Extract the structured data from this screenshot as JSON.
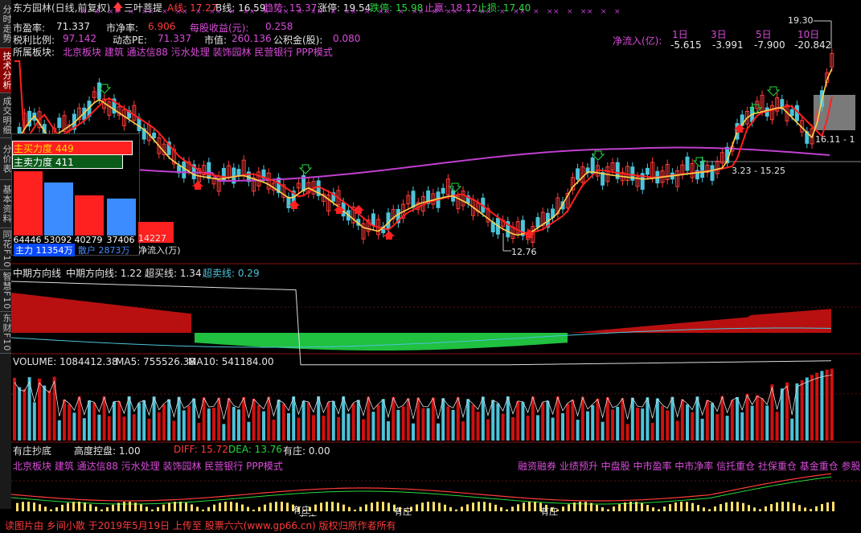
{
  "sidebar": {
    "tabs": [
      {
        "label": "分时走势",
        "active": false
      },
      {
        "label": "技术分析",
        "active": true
      },
      {
        "label": "成交明细",
        "active": false
      },
      {
        "label": "分价表",
        "active": false
      },
      {
        "label": "基本资料",
        "active": false
      },
      {
        "label": "同花F10",
        "active": false
      },
      {
        "label": "智慧F10",
        "active": false
      },
      {
        "label": "东财F10",
        "active": false
      }
    ]
  },
  "header": {
    "stock_name": "东方园林(日线,前复权)",
    "indicator_name": "三叶菩提",
    "a_line": "A线: 17.27",
    "b_line": "B线: 16.59",
    "trend": "趋势: 15.37",
    "limit_up": "涨停: 19.54",
    "limit_down": "跌停: 15.98",
    "take_profit": "止赢: 18.12",
    "stop_loss": "止损: 17.40"
  },
  "fundamentals": {
    "pe_label": "市盈率:",
    "pe_value": "71.337",
    "pb_label": "市净率:",
    "pb_value": "6.906",
    "eps_label": "每股收益(元):",
    "eps_value": "0.258",
    "pre_tax_pe_label": "税利比例:",
    "pre_tax_pe_value": "97.142",
    "dynamic_pe_label": "动态PE:",
    "dynamic_pe_value": "71.337",
    "market_cap_label": "市值:",
    "market_cap_value": "260.136",
    "reserve_label": "公积金(股):",
    "reserve_value": "0.080",
    "sector_label": "所属板块:",
    "sectors": "北京板块    建筑        通达信88 污水处理 装饰园林 民营银行 PPP模式"
  },
  "net_inflow": {
    "label": "净流入(亿):",
    "periods": [
      "1日",
      "3日",
      "5日",
      "10日"
    ],
    "values": [
      "-5.615",
      "-3.991",
      "-7.900",
      "-20.842"
    ]
  },
  "price_labels": {
    "high": "19.30",
    "low": "12.76",
    "band_right": "16.11 - 1",
    "band_mid": "3.23 - 15.25"
  },
  "force_panel": {
    "buy_label": "主买力度 449",
    "sell_label": "主卖力度 411",
    "numbers": [
      "64446",
      "53092",
      "40279",
      "37406",
      "14227"
    ],
    "main_force": "主力 11354万",
    "retail": "散户 2873万",
    "net": "净流入(万)"
  },
  "indicator1": {
    "name": "中期方向线",
    "value_label": "中期方向线: 1.22",
    "overbuy_label": "超买线: 1.34",
    "oversell_label": "超卖线: 0.29"
  },
  "volume": {
    "label": "VOLUME: 1084412.38",
    "ma5": "MA5: 755526.38",
    "ma10": "MA10: 541184.00"
  },
  "indicator2": {
    "name": "有庄抄底",
    "ctrl_label": "高度控盘: 1.00",
    "diff_label": "DIFF: 15.72",
    "dea_label": "DEA: 13.76",
    "zhuang_label": "有庄: 0.00",
    "tags_left": "北京板块       建筑            通达信88 污水处理 装饰园林 民营银行 PPP模式",
    "tags_right": "融资融券 业绩预升 中盘股 中市盈率 中市净率 信托重仓 社保重仓 基金重仓 参股",
    "zhuang_marks": [
      "有庄",
      "有庄",
      "有庄",
      "有庄",
      "有庄"
    ]
  },
  "footer": {
    "credit": "读图片由 乡间小散 于2019年5月19日 上传至 股票六六(www.gp66.cn) 版权归原作者所有"
  },
  "colors": {
    "up": "#ff3b3b",
    "down": "#4cc3d9",
    "ma_yellow": "#ffd24a",
    "ma_magenta": "#c040d0",
    "ma_red": "#ff2020"
  }
}
